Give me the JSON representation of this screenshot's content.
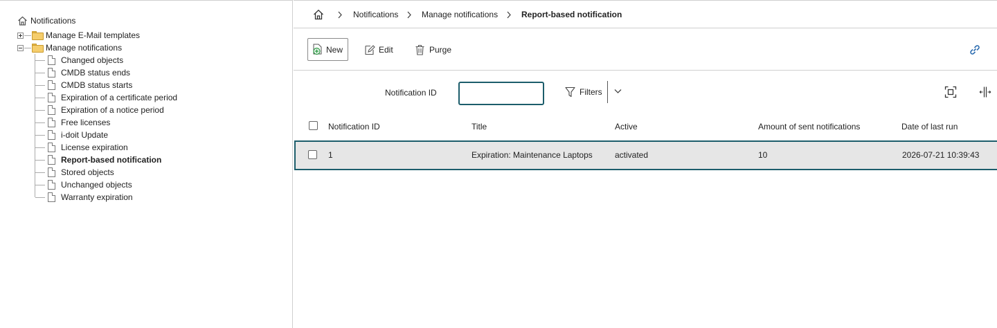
{
  "tree": {
    "root_label": "Notifications",
    "folders": [
      {
        "label": "Manage E-Mail templates",
        "expanded": false
      },
      {
        "label": "Manage notifications",
        "expanded": true
      }
    ],
    "items": [
      {
        "label": "Changed objects",
        "selected": false
      },
      {
        "label": "CMDB status ends",
        "selected": false
      },
      {
        "label": "CMDB status starts",
        "selected": false
      },
      {
        "label": "Expiration of a certificate period",
        "selected": false
      },
      {
        "label": "Expiration of a notice period",
        "selected": false
      },
      {
        "label": "Free licenses",
        "selected": false
      },
      {
        "label": "i-doit Update",
        "selected": false
      },
      {
        "label": "License expiration",
        "selected": false
      },
      {
        "label": "Report-based notification",
        "selected": true
      },
      {
        "label": "Stored objects",
        "selected": false
      },
      {
        "label": "Unchanged objects",
        "selected": false
      },
      {
        "label": "Warranty expiration",
        "selected": false
      }
    ]
  },
  "breadcrumb": {
    "items": [
      "Notifications",
      "Manage notifications"
    ],
    "current": "Report-based notification"
  },
  "toolbar": {
    "new_label": "New",
    "edit_label": "Edit",
    "purge_label": "Purge"
  },
  "filter": {
    "field_label": "Notification ID",
    "value": "",
    "filters_label": "Filters"
  },
  "table": {
    "columns": [
      "Notification ID",
      "Title",
      "Active",
      "Amount of sent notifications",
      "Date of last run"
    ],
    "rows": [
      {
        "id": "1",
        "title": "Expiration: Maintenance Laptops",
        "active": "activated",
        "amount": "10",
        "last_run": "2026-07-21 10:39:43"
      }
    ]
  },
  "colors": {
    "accent": "#1c5d6b",
    "link_icon": "#2b6cb0",
    "new_icon": "#2e9a45",
    "folder": "#f5cd6c"
  }
}
